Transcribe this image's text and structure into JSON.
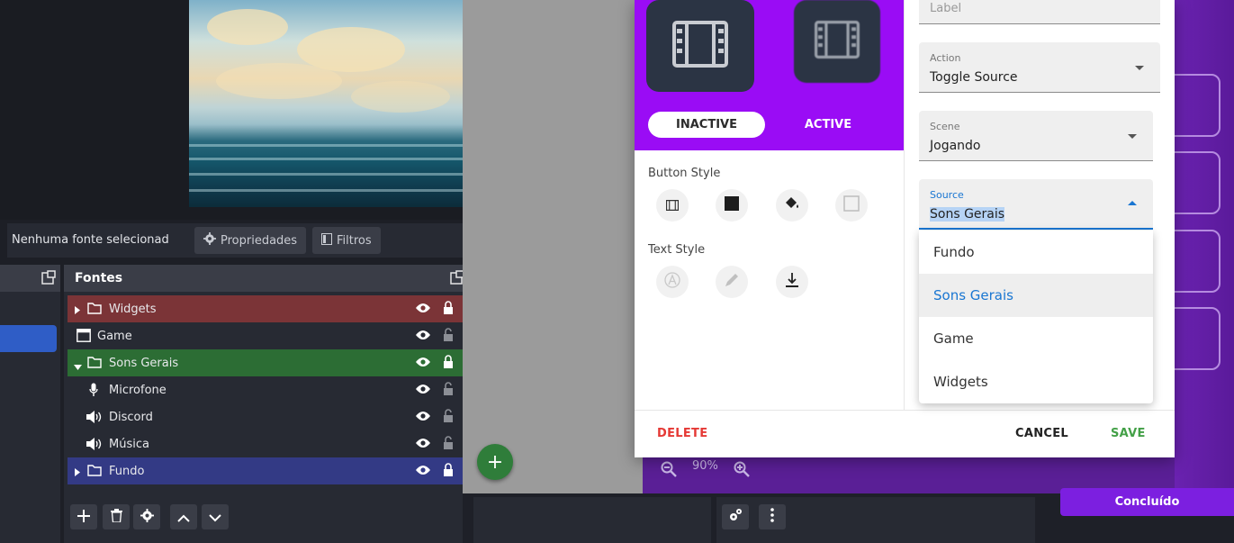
{
  "obs": {
    "no_source_label": "Nenhuma fonte selecionad",
    "properties_label": "Propriedades",
    "filters_label": "Filtros",
    "sources_title": "Fontes",
    "sources": [
      {
        "name": "Widgets",
        "type": "folder",
        "expanded": false,
        "color": "#7b3437"
      },
      {
        "name": "Game",
        "type": "window"
      },
      {
        "name": "Sons Gerais",
        "type": "folder",
        "expanded": true,
        "color": "#2c6d34"
      },
      {
        "name": "Microfone",
        "type": "mic"
      },
      {
        "name": "Discord",
        "type": "audio"
      },
      {
        "name": "Música",
        "type": "audio"
      },
      {
        "name": "Fundo",
        "type": "folder",
        "expanded": false,
        "color": "#333a85"
      }
    ]
  },
  "dialog": {
    "tab_inactive": "INACTIVE",
    "tab_active": "ACTIVE",
    "button_style_label": "Button Style",
    "text_style_label": "Text Style",
    "label_field": {
      "label": "Label"
    },
    "action_field": {
      "label": "Action",
      "value": "Toggle Source"
    },
    "scene_field": {
      "label": "Scene",
      "value": "Jogando"
    },
    "source_field": {
      "label": "Source",
      "value": "Sons Gerais"
    },
    "source_options": [
      "Fundo",
      "Sons Gerais",
      "Game",
      "Widgets"
    ],
    "selected_option": "Sons Gerais",
    "delete_label": "DELETE",
    "cancel_label": "CANCEL",
    "save_label": "SAVE"
  },
  "zoom": {
    "value": "90%"
  },
  "concluido_label": "Concluído",
  "colors": {
    "accent_purple": "#9a0cf5",
    "delete_red": "#e53935",
    "save_green": "#43a047",
    "focus_blue": "#1976d2"
  }
}
